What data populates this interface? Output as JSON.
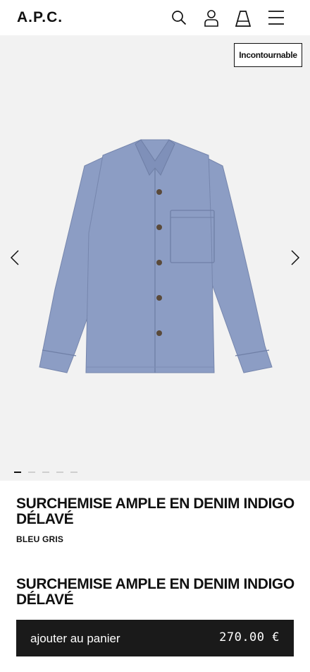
{
  "header": {
    "logo": "A.P.C.",
    "icons": [
      "search-icon",
      "account-icon",
      "cart-icon",
      "menu-icon"
    ]
  },
  "gallery": {
    "badge": "Incontournable",
    "image_count": 5,
    "active_index": 0,
    "shirt_color": "#8c9dc4"
  },
  "product": {
    "title": "SURCHEMISE AMPLE EN DENIM INDIGO DÉLAVÉ",
    "color": "BLEU GRIS"
  },
  "sticky": {
    "title": "SURCHEMISE AMPLE EN DENIM INDIGO DÉLAVÉ",
    "cart_label": "ajouter au panier",
    "price": "270.00 €"
  }
}
